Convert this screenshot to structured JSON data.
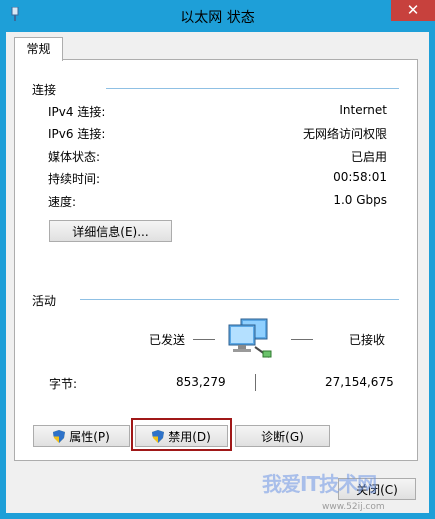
{
  "window": {
    "title": "以太网 状态",
    "close_symbol": "✕",
    "icon": "network-adapter-icon"
  },
  "tabs": [
    {
      "label": "常规"
    }
  ],
  "connection": {
    "title": "连接",
    "rows": [
      {
        "label": "IPv4 连接:",
        "value": "Internet"
      },
      {
        "label": "IPv6 连接:",
        "value": "无网络访问权限"
      },
      {
        "label": "媒体状态:",
        "value": "已启用"
      },
      {
        "label": "持续时间:",
        "value": "00:58:01"
      },
      {
        "label": "速度:",
        "value": "1.0 Gbps"
      }
    ],
    "details_button": "详细信息(E)..."
  },
  "activity": {
    "title": "活动",
    "sent_label": "已发送",
    "received_label": "已接收",
    "bytes_label": "字节:",
    "bytes_sent": "853,279",
    "bytes_received": "27,154,675",
    "icon": "network-computers-icon"
  },
  "buttons": {
    "properties": "属性(P)",
    "disable": "禁用(D)",
    "diagnose": "诊断(G)",
    "close": "关闭(C)"
  },
  "watermark": {
    "text": "我爱IT技术网",
    "url": "www.52ij.com"
  },
  "colors": {
    "title_bar": "#1e9fd8",
    "close_button": "#c7413d",
    "group_line": "#8fc0e4",
    "focus_highlight": "#a01818"
  }
}
